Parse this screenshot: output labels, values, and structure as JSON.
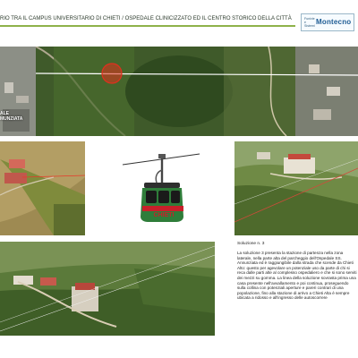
{
  "header": {
    "title": "RIO TRA IL CAMPUS UNIVERSITARIO DI CHIETI / OSPEDALE CLINICIZZATO ED IL CENTRO STORICO DELLA CITTÀ",
    "accent_color": "#8fb24a",
    "logo": {
      "small_text": "Funivie e Sistemi",
      "main_text": "Montecno"
    }
  },
  "aerial": {
    "label": "ALE MUNZIATA",
    "route_color": "#ffffff",
    "marker_color": "#e0301e"
  },
  "cabin": {
    "text": "CHIETI",
    "body_color": "#2f7d3a",
    "accent_color": "#c8202a"
  },
  "description": {
    "title": "Soluzione n. 3",
    "body": "La soluzione 3 presenta la stazione di partenza nella zona laterale, nella parte alta del parcheggio dell'Ospedale SS. Annunziata ed è raggiungibile dalla strada che scende da Chieti Alto: questo per agevolare un potenziale uso da parte di chi si reca dalle parti alte al complesso ospedaliero e che si sono serviti dei mezzi su gomma. La linea della soluzione sovrasta prima una casa presente nell'avvallamento e poi continua, proseguendo sulla collina con potenziali aperture e pareri contrari di una popolazione, fino alla stazione di arrivo a Chieti Alta è sempre ubicata a ridosso e all'ingresso delle autoscorrere"
  }
}
